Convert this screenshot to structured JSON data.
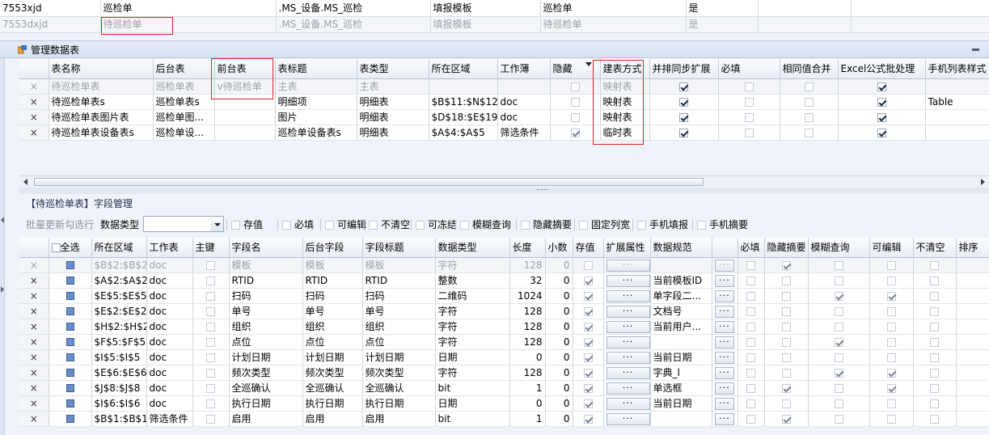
{
  "top_rows": [
    {
      "code": "7553xjd",
      "name": "巡检单",
      "path": ".MS_设备.MS_巡检",
      "type": "填报模板",
      "name2": "巡检单",
      "flag": "是",
      "dim": false
    },
    {
      "code": "7553dxjd",
      "name": "待巡检单",
      "path": ".MS_设备.MS_巡检",
      "type": "填报模板",
      "name2": "待巡检单",
      "flag": "是",
      "dim": true
    }
  ],
  "panel": {
    "title": "管理数据表"
  },
  "tables_grid": {
    "columns": [
      "表名称",
      "后台表",
      "前台表",
      "表标题",
      "表类型",
      "所在区域",
      "工作薄",
      "隐藏",
      "建表方式",
      "并排同步扩展",
      "必填",
      "相同值合并",
      "Excel公式批处理",
      "手机列表样式"
    ],
    "rows": [
      {
        "name": "待巡检单表",
        "back": "巡检单表",
        "front": "v待巡检单",
        "title": "主表",
        "type": "主表",
        "area": "",
        "book": "",
        "hidden": false,
        "mode": "映射表",
        "sync": true,
        "req": false,
        "merge": false,
        "excel": true,
        "mobile": "",
        "dim": true
      },
      {
        "name": "待巡检单表s",
        "back": "巡检单表s",
        "front": "",
        "title": "明细项",
        "type": "明细表",
        "area": "$B$11:$N$12",
        "book": "doc",
        "hidden": false,
        "mode": "映射表",
        "sync": true,
        "req": false,
        "merge": false,
        "excel": true,
        "mobile": "Table",
        "dim": false
      },
      {
        "name": "待巡检单表图片表",
        "back": "巡检单图...",
        "front": "",
        "title": "图片",
        "type": "明细表",
        "area": "$D$18:$E$19",
        "book": "doc",
        "hidden": false,
        "mode": "映射表",
        "sync": true,
        "req": false,
        "merge": false,
        "excel": true,
        "mobile": "",
        "dim": false
      },
      {
        "name": "待巡检单表设备表s",
        "back": "巡检单设...",
        "front": "",
        "title": "巡检单设备表s",
        "type": "明细表",
        "area": "$A$4:$A$5",
        "book": "筛选条件",
        "hidden": true,
        "mode": "临时表",
        "sync": true,
        "req": false,
        "merge": false,
        "excel": true,
        "mobile": "",
        "dim": false
      }
    ],
    "delete_glyph": "×"
  },
  "field_section": {
    "title": "【待巡检单表】字段管理"
  },
  "toolbar": {
    "batch_label": "批量更新勾选行",
    "dtype_label": "数据类型",
    "checks": [
      "存值",
      "必填",
      "可编辑",
      "不清空",
      "可冻结",
      "模糊查询",
      "隐藏摘要",
      "固定列宽",
      "手机填报",
      "手机摘要"
    ]
  },
  "fields_grid": {
    "columns": [
      "",
      "全选",
      "所在区域",
      "工作表",
      "主键",
      "字段名",
      "后台字段",
      "字段标题",
      "数据类型",
      "长度",
      "小数",
      "存值",
      "扩展属性",
      "数据规范",
      "",
      "必填",
      "隐藏摘要",
      "模糊查询",
      "可编辑",
      "不清空",
      "排序"
    ],
    "dots": "···",
    "rows": [
      {
        "area": "$B$2:$B$2",
        "sheet": "doc",
        "pk": false,
        "name": "模板",
        "back": "模板",
        "title": "模板",
        "dtype": "字符",
        "len": "128",
        "dec": "0",
        "store": false,
        "spec": "",
        "req": false,
        "hide": true,
        "fuzzy": false,
        "edit": false,
        "keep": false,
        "dim": true
      },
      {
        "area": "$A$2:$A$2",
        "sheet": "doc",
        "pk": false,
        "name": "RTID",
        "back": "RTID",
        "title": "RTID",
        "dtype": "整数",
        "len": "32",
        "dec": "0",
        "store": true,
        "spec": "当前模板ID",
        "req": false,
        "hide": false,
        "fuzzy": false,
        "edit": false,
        "keep": false,
        "dim": false
      },
      {
        "area": "$E$5:$E$5",
        "sheet": "doc",
        "pk": false,
        "name": "扫码",
        "back": "扫码",
        "title": "扫码",
        "dtype": "二维码",
        "len": "1024",
        "dec": "0",
        "store": true,
        "spec": "单字段二...",
        "req": false,
        "hide": false,
        "fuzzy": true,
        "edit": true,
        "keep": false,
        "dim": false
      },
      {
        "area": "$E$2:$E$2",
        "sheet": "doc",
        "pk": false,
        "name": "单号",
        "back": "单号",
        "title": "单号",
        "dtype": "字符",
        "len": "128",
        "dec": "0",
        "store": true,
        "spec": "文档号",
        "req": false,
        "hide": false,
        "fuzzy": false,
        "edit": false,
        "keep": false,
        "dim": false
      },
      {
        "area": "$H$2:$H$2",
        "sheet": "doc",
        "pk": false,
        "name": "组织",
        "back": "组织",
        "title": "组织",
        "dtype": "字符",
        "len": "128",
        "dec": "0",
        "store": true,
        "spec": "当前用户...",
        "req": false,
        "hide": false,
        "fuzzy": false,
        "edit": false,
        "keep": false,
        "dim": false
      },
      {
        "area": "$F$5:$F$5",
        "sheet": "doc",
        "pk": false,
        "name": "点位",
        "back": "点位",
        "title": "点位",
        "dtype": "字符",
        "len": "128",
        "dec": "0",
        "store": true,
        "spec": "",
        "req": false,
        "hide": false,
        "fuzzy": true,
        "edit": false,
        "keep": false,
        "dim": false
      },
      {
        "area": "$I$5:$I$5",
        "sheet": "doc",
        "pk": false,
        "name": "计划日期",
        "back": "计划日期",
        "title": "计划日期",
        "dtype": "日期",
        "len": "0",
        "dec": "0",
        "store": true,
        "spec": "当前日期",
        "req": false,
        "hide": false,
        "fuzzy": false,
        "edit": false,
        "keep": false,
        "dim": false
      },
      {
        "area": "$E$6:$E$6",
        "sheet": "doc",
        "pk": false,
        "name": "频次类型",
        "back": "频次类型",
        "title": "频次类型",
        "dtype": "字符",
        "len": "128",
        "dec": "0",
        "store": true,
        "spec": "字典_l",
        "req": false,
        "hide": false,
        "fuzzy": true,
        "edit": true,
        "keep": false,
        "dim": false
      },
      {
        "area": "$J$8:$J$8",
        "sheet": "doc",
        "pk": false,
        "name": "全巡确认",
        "back": "全巡确认",
        "title": "全巡确认",
        "dtype": "bit",
        "len": "1",
        "dec": "0",
        "store": true,
        "spec": "单选框",
        "req": false,
        "hide": true,
        "fuzzy": false,
        "edit": true,
        "keep": false,
        "dim": false
      },
      {
        "area": "$I$6:$I$6",
        "sheet": "doc",
        "pk": false,
        "name": "执行日期",
        "back": "执行日期",
        "title": "执行日期",
        "dtype": "日期",
        "len": "0",
        "dec": "0",
        "store": true,
        "spec": "当前日期",
        "req": false,
        "hide": false,
        "fuzzy": false,
        "edit": false,
        "keep": false,
        "dim": false
      },
      {
        "area": "$B$1:$B$1",
        "sheet": "筛选条件",
        "pk": false,
        "name": "启用",
        "back": "启用",
        "title": "启用",
        "dtype": "bit",
        "len": "1",
        "dec": "0",
        "store": true,
        "spec": "",
        "req": false,
        "hide": true,
        "fuzzy": false,
        "edit": false,
        "keep": false,
        "dim": false
      }
    ]
  },
  "colors": {
    "highlight": "#d9252b",
    "accent": "#6a8fc6"
  }
}
